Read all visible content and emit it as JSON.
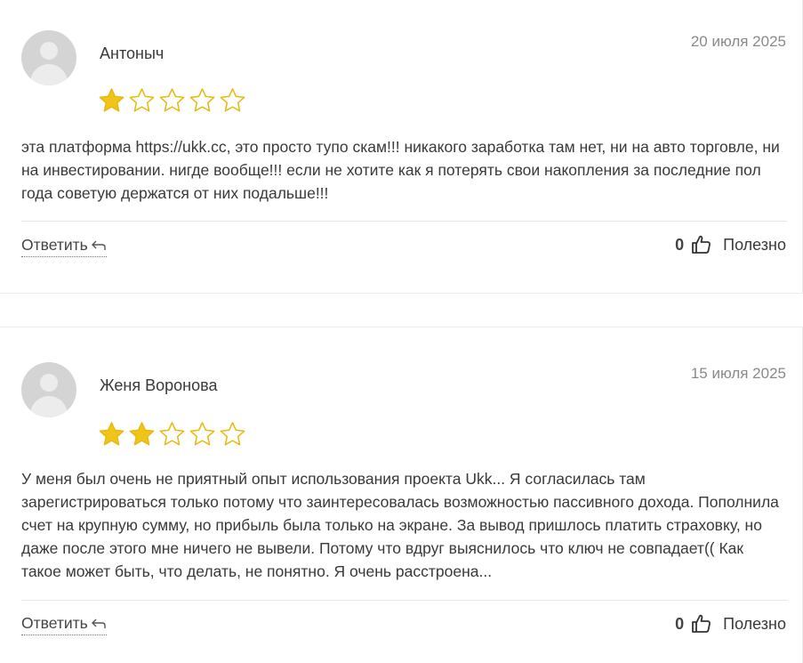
{
  "reviews": [
    {
      "author": "Антоныч",
      "date": "20 июля 2025",
      "rating": 1,
      "max_rating": 5,
      "text": "эта платформа https://ukk.cc, это просто тупо скам!!! никакого заработка там нет, ни на авто торговле, ни на инвестировании. нигде вообще!!! если не хотите как я потерять свои накопления за последние пол года советую держатся от них подальше!!!",
      "reply_label": "Ответить",
      "likes": "0",
      "helpful_label": "Полезно"
    },
    {
      "author": "Женя Воронова",
      "date": "15 июля 2025",
      "rating": 2,
      "max_rating": 5,
      "text": "У меня был очень не приятный опыт использования проекта Ukk... Я согласилась там зарегистрироваться только потому что заинтересовалась возможностью пассивного дохода. Пополнила счет на крупную сумму, но прибыль была только на экране. За вывод пришлось платить страховку, но даже после этого мне ничего не вывели. Потому что вдруг выяснилось что ключ не совпадает(( Как такое может быть, что делать, не понятно. Я очень расстроена...",
      "reply_label": "Ответить",
      "likes": "0",
      "helpful_label": "Полезно"
    }
  ],
  "colors": {
    "star_filled": "#f0c419",
    "star_outline": "#e8b90e",
    "text": "#3a3a3a",
    "date": "#8a8a8a"
  },
  "icons": {
    "avatar": "default-avatar-icon",
    "star": "star-icon",
    "reply": "reply-arrow-icon",
    "like": "thumbs-up-icon"
  }
}
